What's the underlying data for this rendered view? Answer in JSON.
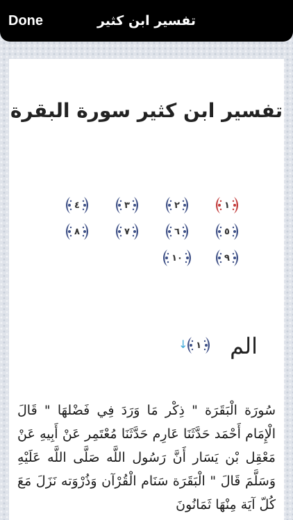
{
  "nav": {
    "done_label": "Done",
    "title": "تفسير ابن كثير"
  },
  "content": {
    "title": "تفسير ابن كثير سورة البقرة",
    "verses": [
      {
        "label": "١",
        "active": true
      },
      {
        "label": "٢",
        "active": false
      },
      {
        "label": "٣",
        "active": false
      },
      {
        "label": "٤",
        "active": false
      },
      {
        "label": "٥",
        "active": false
      },
      {
        "label": "٦",
        "active": false
      },
      {
        "label": "٧",
        "active": false
      },
      {
        "label": "٨",
        "active": false
      },
      {
        "label": "٩",
        "active": false
      },
      {
        "label": "١٠",
        "active": false
      }
    ],
    "ayah": {
      "text": "الم",
      "number": "١",
      "arrow": "↓"
    },
    "body": "سُورَة الْبَقَرَة \" ذِكْر مَا وَرَدَ فِي فَضْلهَا \" قَالَ الْإِمَام أَحْمَد حَدَّثَنَا عَارِم حَدَّثَنَا مُعْتَمِر عَنْ أَبِيهِ عَنْ مَعْقِل بْن يَسَار أَنَّ رَسُول اللَّه صَلَّى اللَّه عَلَيْهِ وَسَلَّمَ قَالَ \" الْبَقَرَة سَنَام الْقُرْآن وَذُرْوَته نَزَلَ مَعَ كُلّ آيَة مِنْهَا ثَمَانُونَ"
  },
  "colors": {
    "topbar": "#000000",
    "card": "#ffffff",
    "marker_active": "#c23b3b",
    "marker_default": "#3d4f86",
    "arrow": "#3aa7d8"
  }
}
